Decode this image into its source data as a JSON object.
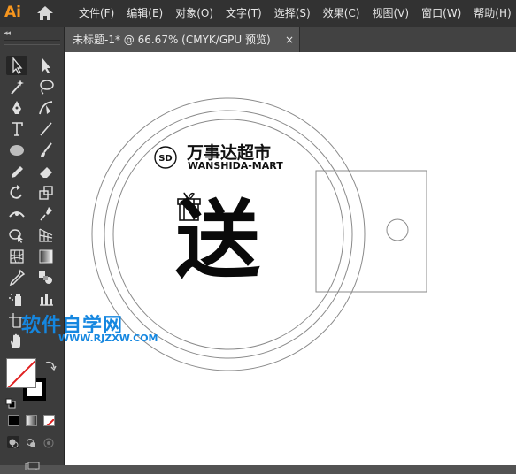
{
  "app": {
    "logo_text": "Ai"
  },
  "menu": {
    "items": [
      {
        "label": "文件(F)"
      },
      {
        "label": "编辑(E)"
      },
      {
        "label": "对象(O)"
      },
      {
        "label": "文字(T)"
      },
      {
        "label": "选择(S)"
      },
      {
        "label": "效果(C)"
      },
      {
        "label": "视图(V)"
      },
      {
        "label": "窗口(W)"
      },
      {
        "label": "帮助(H)"
      }
    ]
  },
  "document_tab": {
    "title": "未标题-1* @ 66.67% (CMYK/GPU 预览)",
    "close_glyph": "×"
  },
  "toolbar": {
    "collapse_glyph": "◂◂"
  },
  "artwork": {
    "brand_cn": "万事达超市",
    "brand_en": "WANSHIDA-MART",
    "logo_badge": "SD",
    "headline_char": "送"
  },
  "watermark": {
    "cn": "软件自学网",
    "en": "WWW.RJZXW.COM"
  },
  "colors": {
    "accent_logo": "#f7961e",
    "watermark": "#1587e0",
    "canvas": "#ffffff",
    "ui_dark": "#323232"
  }
}
